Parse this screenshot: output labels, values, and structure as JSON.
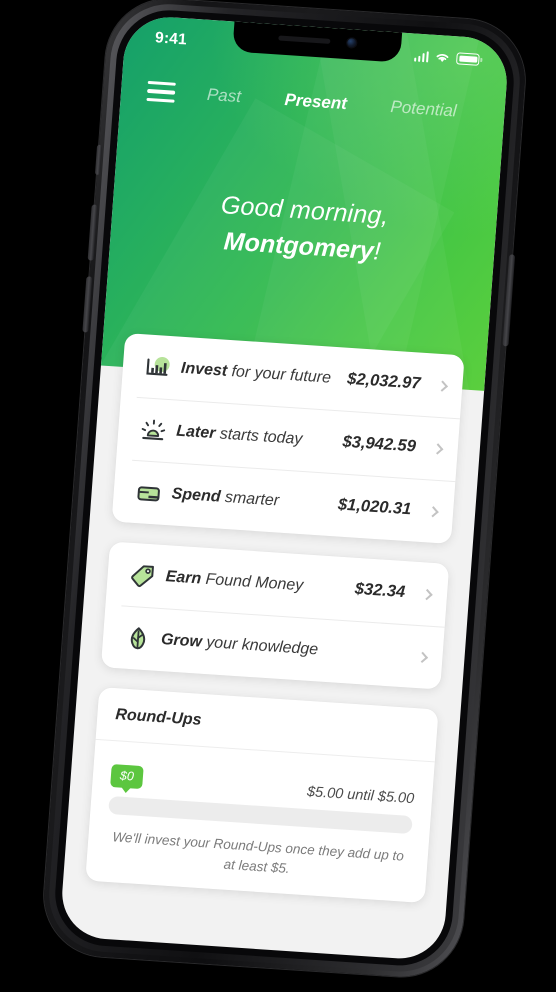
{
  "status_bar": {
    "time": "9:41",
    "signal_icon": "cellular-signal-icon",
    "wifi_icon": "wifi-icon",
    "battery_icon": "battery-full-icon"
  },
  "nav": {
    "menu_icon": "hamburger-menu-icon",
    "tabs": [
      {
        "label": "Past",
        "active": false
      },
      {
        "label": "Present",
        "active": true
      },
      {
        "label": "Potential",
        "active": false
      }
    ]
  },
  "greeting": {
    "line1": "Good morning,",
    "name": "Montgomery",
    "punctuation": "!"
  },
  "accounts_card": {
    "rows": [
      {
        "icon": "bar-chart-icon",
        "label_bold": "Invest",
        "label_rest": " for your future",
        "amount": "$2,032.97",
        "chevron": "chevron-right-icon"
      },
      {
        "icon": "sunrise-icon",
        "label_bold": "Later",
        "label_rest": " starts today",
        "amount": "$3,942.59",
        "chevron": "chevron-right-icon"
      },
      {
        "icon": "credit-card-icon",
        "label_bold": "Spend",
        "label_rest": " smarter",
        "amount": "$1,020.31",
        "chevron": "chevron-right-icon"
      }
    ]
  },
  "extras_card": {
    "rows": [
      {
        "icon": "price-tag-icon",
        "label_bold": "Earn",
        "label_rest": " Found Money",
        "amount": "$32.34",
        "chevron": "chevron-right-icon"
      },
      {
        "icon": "leaf-icon",
        "label_bold": "Grow",
        "label_rest": " your knowledge",
        "amount": "",
        "chevron": "chevron-right-icon"
      }
    ]
  },
  "roundups_card": {
    "title": "Round-Ups",
    "badge_amount": "$0",
    "until_text": "$5.00 until $5.00",
    "progress_percent": 0,
    "note": "We'll invest your Round-Ups once they add up to at least $5."
  },
  "colors": {
    "gradient_start": "#15a06a",
    "gradient_end": "#5bcf3e",
    "accent_green": "#5cc63f",
    "icon_blob_green": "#b7e39a",
    "background_gray": "#f2f2f2",
    "card_white": "#ffffff"
  }
}
